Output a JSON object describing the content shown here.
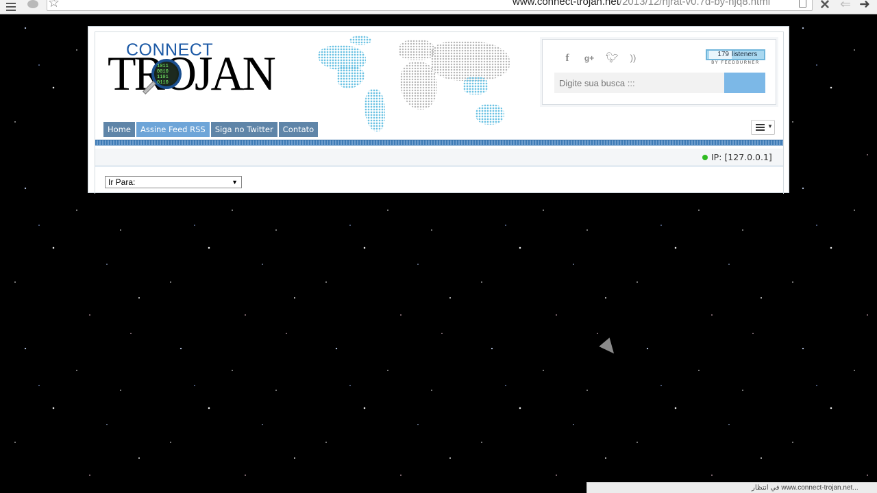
{
  "browser": {
    "url_host": "www.connect-trojan.net",
    "url_path": "/2013/12/njrat-v0.7d-by-njq8.html",
    "icons": [
      "menu-icon",
      "extension-icon",
      "star-icon",
      "page-icon",
      "close-icon",
      "back-icon",
      "forward-icon"
    ]
  },
  "site": {
    "logo_top": "CONNECT",
    "logo_main": "TROJAN",
    "logo_bits": "1011\n0010\n1101\n0110",
    "social_icons": [
      "facebook-icon",
      "google-plus-icon",
      "twitter-icon",
      "rss-icon"
    ],
    "feedburner": {
      "count": "179",
      "label": "listeners",
      "by": "BY FEEDBURNER"
    },
    "search": {
      "placeholder": "Digite sua busca :::"
    },
    "nav": [
      {
        "label": "Home"
      },
      {
        "label": "Assine Feed RSS"
      },
      {
        "label": "Siga no Twitter"
      },
      {
        "label": "Contato"
      }
    ],
    "ip": "IP: [127.0.0.1]",
    "goto": "Ir Para:"
  },
  "status_bar": "...www.connect-trojan.net في انتظار"
}
